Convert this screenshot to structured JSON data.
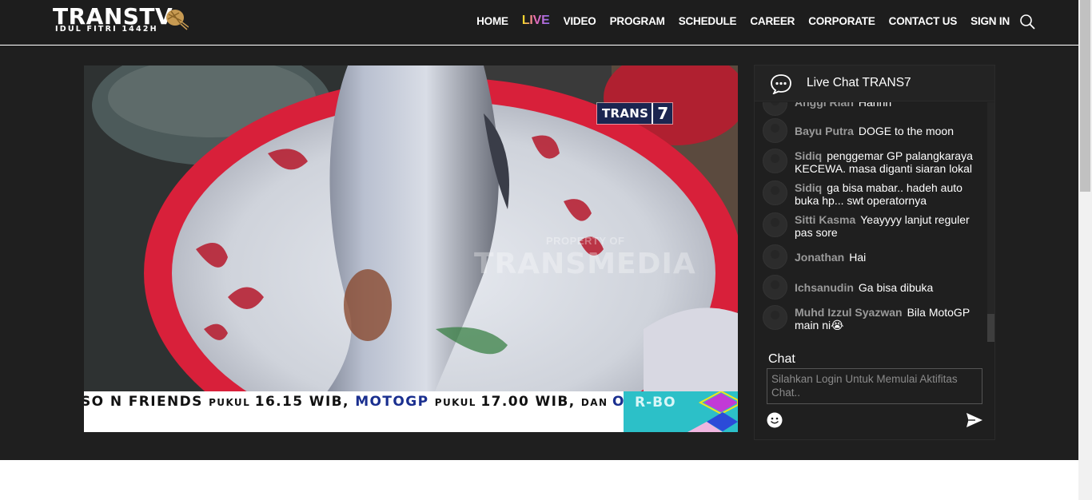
{
  "logo": {
    "main": "TRANSTV",
    "sub": "IDUL FITRI 1442H"
  },
  "nav": {
    "items": [
      "HOME",
      "LIVE",
      "VIDEO",
      "PROGRAM",
      "SCHEDULE",
      "CAREER",
      "CORPORATE",
      "CONTACT US",
      "SIGN IN"
    ],
    "search_icon": "search-icon"
  },
  "video": {
    "channel_logo": {
      "name": "TRANS",
      "number": "7"
    },
    "watermark_small": "PROPERTY OF",
    "watermark_big": "TRANSMEDIA",
    "ticker": {
      "seg1": "SO N FRIENDS ",
      "seg2": "PUKUL ",
      "seg3": "16.15 WIB, ",
      "seg4": "MOTOGP ",
      "seg5": "PUKUL ",
      "seg6": "17.00 WIB, ",
      "seg7": "DAN ",
      "seg8": "OPERA",
      "end": "R-BO"
    }
  },
  "chat": {
    "title": "Live Chat TRANS7",
    "messages": [
      {
        "name": "Anggi Rian",
        "text": "Hahhh"
      },
      {
        "name": "Bayu Putra",
        "text": "DOGE to the moon"
      },
      {
        "name": "Sidiq",
        "text": "penggemar GP palangkaraya KECEWA. masa diganti siaran lokal"
      },
      {
        "name": "Sidiq",
        "text": "ga bisa mabar.. hadeh auto buka hp... swt operatornya"
      },
      {
        "name": "Sitti Kasma",
        "text": "Yeayyyy lanjut reguler pas sore"
      },
      {
        "name": "Jonathan",
        "text": "Hai"
      },
      {
        "name": "Ichsanudin",
        "text": "Ga bisa dibuka"
      },
      {
        "name": "Muhd Izzul Syazwan",
        "text": "Bila MotoGP main ni😭"
      }
    ],
    "label": "Chat",
    "placeholder": "Silahkan Login Untuk Memulai Aktifitas Chat..",
    "emoji_icon": "emoji-icon",
    "send_icon": "send-icon"
  },
  "colors": {
    "header_bg": "#1d1d1d",
    "main_bg": "#1f1f1f",
    "ticker_accent": "#1a2f8f",
    "ticker_end": "#2cc0c8"
  }
}
